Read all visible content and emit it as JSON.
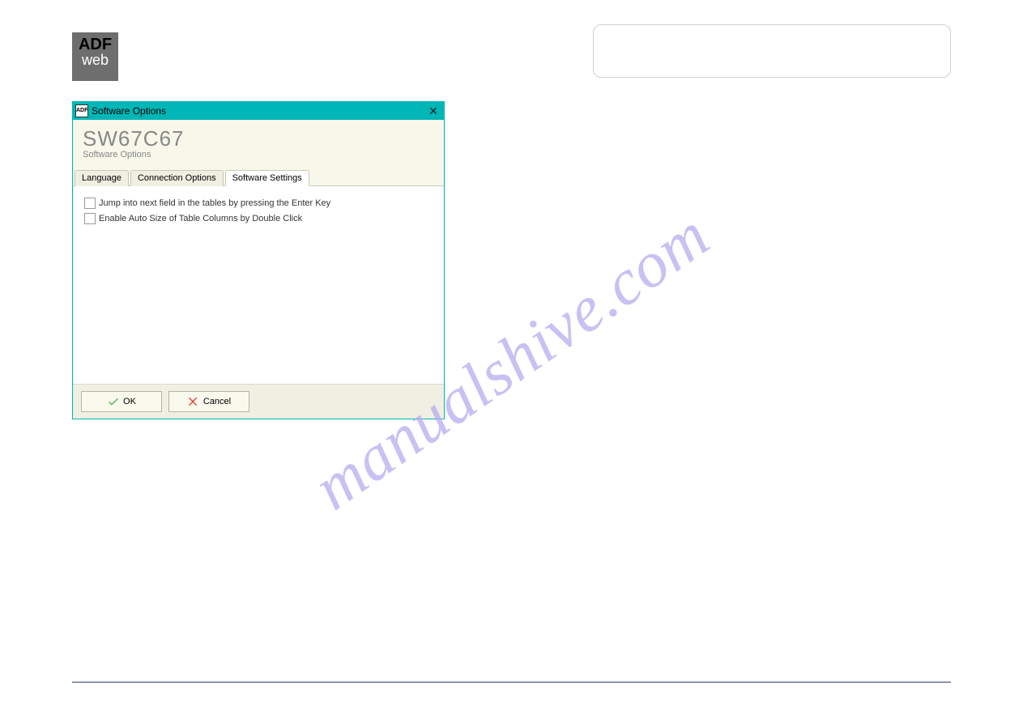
{
  "logo": {
    "line1": "ADF",
    "line2": "web"
  },
  "dialog": {
    "window_title": "Software Options",
    "main_title": "SW67C67",
    "subtitle": "Software Options",
    "tabs": [
      {
        "label": "Language"
      },
      {
        "label": "Connection Options"
      },
      {
        "label": "Software Settings"
      }
    ],
    "checkboxes": [
      {
        "label": "Jump into next field in the tables by pressing the Enter Key"
      },
      {
        "label": "Enable Auto Size of Table Columns by Double Click"
      }
    ],
    "buttons": {
      "ok": "OK",
      "cancel": "Cancel"
    }
  },
  "watermark": "manualshive.com"
}
